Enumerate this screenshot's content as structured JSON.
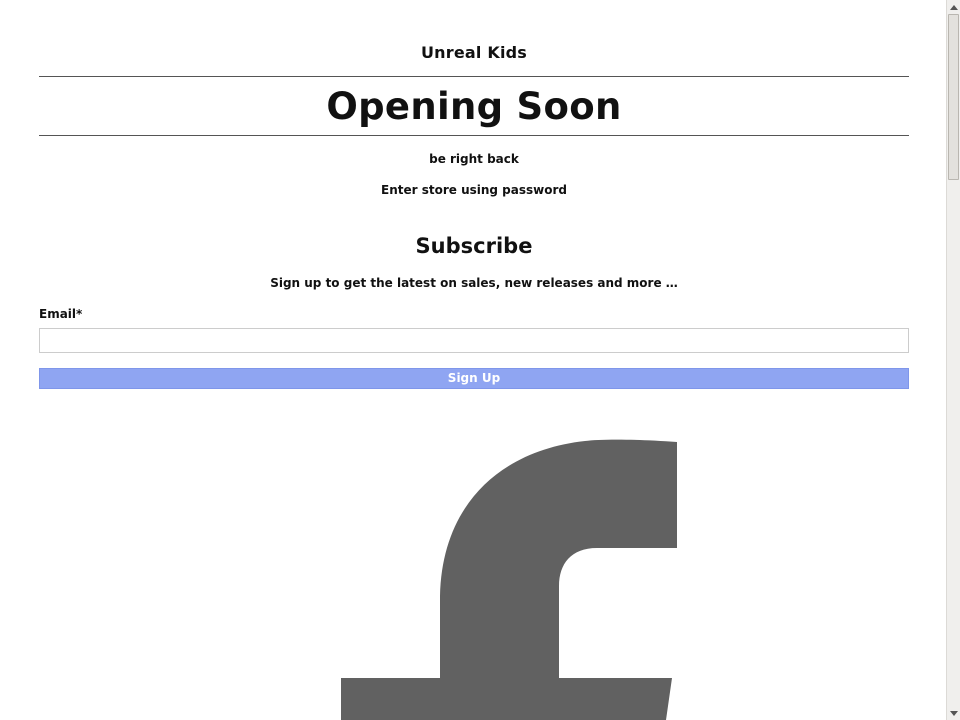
{
  "header": {
    "store_name": "Unreal Kids",
    "headline": "Opening Soon"
  },
  "main": {
    "message": "be right back",
    "password_link": "Enter store using password"
  },
  "newsletter": {
    "heading": "Subscribe",
    "subtext": "Sign up to get the latest on sales, new releases and more …",
    "email_label": "Email*",
    "email_value": "",
    "email_placeholder": "",
    "button_label": "Sign Up"
  },
  "social": {
    "icon": "facebook-icon"
  },
  "colors": {
    "button_bg": "#8fa5f2",
    "icon": "#616161",
    "rule": "#555555"
  }
}
